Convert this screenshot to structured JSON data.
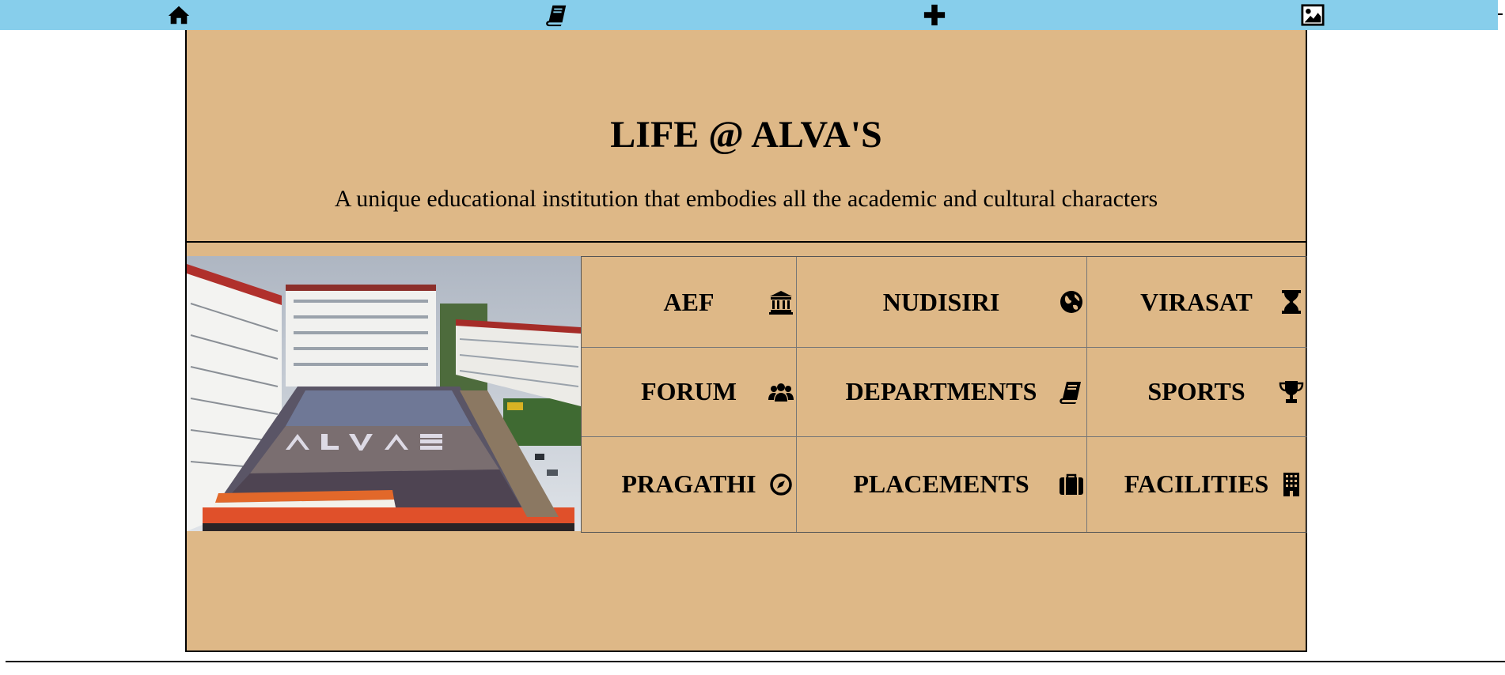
{
  "nav": {
    "icons": [
      "home-icon",
      "book-icon",
      "plus-icon",
      "image-icon"
    ]
  },
  "hero": {
    "title": "LIFE @ ALVA'S",
    "subtitle": "A unique educational institution that embodies all the academic and cultural characters"
  },
  "photo": {
    "banner_text": "ALVA'S"
  },
  "grid": {
    "items": [
      {
        "label": "AEF",
        "icon": "institution-icon"
      },
      {
        "label": "NUDISIRI",
        "icon": "globe-icon"
      },
      {
        "label": "VIRASAT",
        "icon": "hourglass-icon"
      },
      {
        "label": "FORUM",
        "icon": "users-icon"
      },
      {
        "label": "DEPARTMENTS",
        "icon": "book-icon"
      },
      {
        "label": "SPORTS",
        "icon": "trophy-icon"
      },
      {
        "label": "PRAGATHI",
        "icon": "compass-icon"
      },
      {
        "label": "PLACEMENTS",
        "icon": "briefcase-icon"
      },
      {
        "label": "FACILITIES",
        "icon": "building-icon"
      }
    ]
  },
  "colors": {
    "nav_bg": "#87ceeb",
    "panel_bg": "#deb887"
  }
}
